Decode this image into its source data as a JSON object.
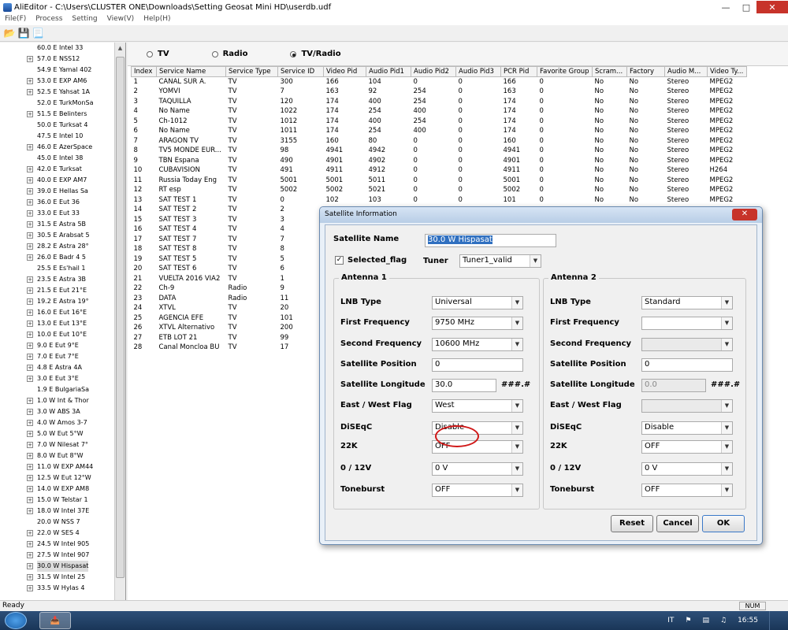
{
  "window": {
    "title": "AliEditor - C:\\Users\\CLUSTER ONE\\Downloads\\Setting Geosat Mini HD\\userdb.udf"
  },
  "menu": [
    "File(F)",
    "Process",
    "Setting",
    "View(V)",
    "Help(H)"
  ],
  "toolbar_icons": [
    "open-folder-icon",
    "save-icon",
    "open-file-icon"
  ],
  "tree": [
    {
      "label": "60.0 E Intel 33",
      "expand": false
    },
    {
      "label": "57.0 E NSS12",
      "expand": true
    },
    {
      "label": "54.9 E Yamal 402",
      "expand": false
    },
    {
      "label": "53.0 E EXP AM6",
      "expand": true
    },
    {
      "label": "52.5 E Yahsat 1A",
      "expand": true
    },
    {
      "label": "52.0 E TurkMonSa",
      "expand": false
    },
    {
      "label": "51.5 E Belinters",
      "expand": true
    },
    {
      "label": "50.0 E Turksat 4",
      "expand": false
    },
    {
      "label": "47.5 E Intel 10",
      "expand": false
    },
    {
      "label": "46.0 E AzerSpace",
      "expand": true
    },
    {
      "label": "45.0 E Intel 38",
      "expand": false
    },
    {
      "label": "42.0 E Turksat",
      "expand": true
    },
    {
      "label": "40.0 E EXP AM7",
      "expand": true
    },
    {
      "label": "39.0 E Hellas Sa",
      "expand": true
    },
    {
      "label": "36.0 E Eut 36",
      "expand": true
    },
    {
      "label": "33.0 E Eut 33",
      "expand": true
    },
    {
      "label": "31.5 E Astra 5B",
      "expand": true
    },
    {
      "label": "30.5 E Arabsat 5",
      "expand": true
    },
    {
      "label": "28.2 E Astra 28°",
      "expand": true
    },
    {
      "label": "26.0 E Badr 4 5",
      "expand": true
    },
    {
      "label": "25.5 E Es'hail 1",
      "expand": false
    },
    {
      "label": "23.5 E Astra 3B",
      "expand": true
    },
    {
      "label": "21.5 E Eut 21°E",
      "expand": true
    },
    {
      "label": "19.2 E Astra 19°",
      "expand": true
    },
    {
      "label": "16.0 E Eut 16°E",
      "expand": true
    },
    {
      "label": "13.0 E Eut 13°E",
      "expand": true
    },
    {
      "label": "10.0 E Eut 10°E",
      "expand": true
    },
    {
      "label": "9.0 E Eut 9°E",
      "expand": true
    },
    {
      "label": "7.0 E Eut 7°E",
      "expand": true
    },
    {
      "label": "4.8 E Astra 4A",
      "expand": true
    },
    {
      "label": "3.0 E Eut 3°E",
      "expand": true
    },
    {
      "label": "1.9 E BulgariaSa",
      "expand": false
    },
    {
      "label": "1.0 W Int & Thor",
      "expand": true
    },
    {
      "label": "3.0 W ABS 3A",
      "expand": true
    },
    {
      "label": "4.0 W Amos 3-7",
      "expand": true
    },
    {
      "label": "5.0 W Eut 5°W",
      "expand": true
    },
    {
      "label": "7.0 W Nilesat 7°",
      "expand": true
    },
    {
      "label": "8.0 W Eut 8°W",
      "expand": true
    },
    {
      "label": "11.0 W EXP AM44",
      "expand": true
    },
    {
      "label": "12.5 W Eut 12°W",
      "expand": true
    },
    {
      "label": "14.0 W EXP AM8",
      "expand": true
    },
    {
      "label": "15.0 W Telstar 1",
      "expand": true
    },
    {
      "label": "18.0 W Intel 37E",
      "expand": true
    },
    {
      "label": "20.0 W NSS 7",
      "expand": false
    },
    {
      "label": "22.0 W SES 4",
      "expand": true
    },
    {
      "label": "24.5 W Intel 905",
      "expand": true
    },
    {
      "label": "27.5 W Intel 907",
      "expand": true
    },
    {
      "label": "30.0 W Hispasat",
      "expand": true,
      "selected": true
    },
    {
      "label": "31.5 W Intel 25",
      "expand": true
    },
    {
      "label": "33.5 W Hylas 4",
      "expand": true
    }
  ],
  "tabs": {
    "tv": "TV",
    "radio": "Radio",
    "tvradio": "TV/Radio",
    "selected": "tvradio"
  },
  "columns": [
    "Index",
    "Service Name",
    "Service Type",
    "Service ID",
    "Video Pid",
    "Audio Pid1",
    "Audio Pid2",
    "Audio Pid3",
    "PCR Pid",
    "Favorite Group",
    "Scram...",
    "Factory",
    "Audio M...",
    "Video Ty..."
  ],
  "rows": [
    [
      "1",
      "CANAL SUR A.",
      "TV",
      "300",
      "166",
      "104",
      "0",
      "0",
      "166",
      "0",
      "No",
      "No",
      "Stereo",
      "MPEG2"
    ],
    [
      "2",
      "YOMVI",
      "TV",
      "7",
      "163",
      "92",
      "254",
      "0",
      "163",
      "0",
      "No",
      "No",
      "Stereo",
      "MPEG2"
    ],
    [
      "3",
      "TAQUILLA",
      "TV",
      "120",
      "174",
      "400",
      "254",
      "0",
      "174",
      "0",
      "No",
      "No",
      "Stereo",
      "MPEG2"
    ],
    [
      "4",
      "No Name",
      "TV",
      "1022",
      "174",
      "254",
      "400",
      "0",
      "174",
      "0",
      "No",
      "No",
      "Stereo",
      "MPEG2"
    ],
    [
      "5",
      "Ch-1012",
      "TV",
      "1012",
      "174",
      "400",
      "254",
      "0",
      "174",
      "0",
      "No",
      "No",
      "Stereo",
      "MPEG2"
    ],
    [
      "6",
      "No Name",
      "TV",
      "1011",
      "174",
      "254",
      "400",
      "0",
      "174",
      "0",
      "No",
      "No",
      "Stereo",
      "MPEG2"
    ],
    [
      "7",
      "ARAGON TV",
      "TV",
      "3155",
      "160",
      "80",
      "0",
      "0",
      "160",
      "0",
      "No",
      "No",
      "Stereo",
      "MPEG2"
    ],
    [
      "8",
      "TV5 MONDE EUR...",
      "TV",
      "98",
      "4941",
      "4942",
      "0",
      "0",
      "4941",
      "0",
      "No",
      "No",
      "Stereo",
      "MPEG2"
    ],
    [
      "9",
      "TBN Espana",
      "TV",
      "490",
      "4901",
      "4902",
      "0",
      "0",
      "4901",
      "0",
      "No",
      "No",
      "Stereo",
      "MPEG2"
    ],
    [
      "10",
      "CUBAVISION",
      "TV",
      "491",
      "4911",
      "4912",
      "0",
      "0",
      "4911",
      "0",
      "No",
      "No",
      "Stereo",
      "H264"
    ],
    [
      "11",
      "Russia Today Eng",
      "TV",
      "5001",
      "5001",
      "5011",
      "0",
      "0",
      "5001",
      "0",
      "No",
      "No",
      "Stereo",
      "MPEG2"
    ],
    [
      "12",
      "RT esp",
      "TV",
      "5002",
      "5002",
      "5021",
      "0",
      "0",
      "5002",
      "0",
      "No",
      "No",
      "Stereo",
      "MPEG2"
    ],
    [
      "13",
      "SAT TEST 1",
      "TV",
      "0",
      "102",
      "103",
      "0",
      "0",
      "101",
      "0",
      "No",
      "No",
      "Stereo",
      "MPEG2"
    ],
    [
      "14",
      "SAT TEST 2",
      "TV",
      "2",
      "",
      "",
      "",
      "",
      "",
      "",
      "",
      "",
      "",
      ""
    ],
    [
      "15",
      "SAT TEST 3",
      "TV",
      "3",
      "",
      "",
      "",
      "",
      "",
      "",
      "",
      "",
      "",
      ""
    ],
    [
      "16",
      "SAT TEST 4",
      "TV",
      "4",
      "",
      "",
      "",
      "",
      "",
      "",
      "",
      "",
      "",
      ""
    ],
    [
      "17",
      "SAT TEST 7",
      "TV",
      "7",
      "",
      "",
      "",
      "",
      "",
      "",
      "",
      "",
      "",
      ""
    ],
    [
      "18",
      "SAT TEST 8",
      "TV",
      "8",
      "",
      "",
      "",
      "",
      "",
      "",
      "",
      "",
      "",
      ""
    ],
    [
      "19",
      "SAT TEST 5",
      "TV",
      "5",
      "",
      "",
      "",
      "",
      "",
      "",
      "",
      "",
      "",
      ""
    ],
    [
      "20",
      "SAT TEST 6",
      "TV",
      "6",
      "",
      "",
      "",
      "",
      "",
      "",
      "",
      "",
      "",
      ""
    ],
    [
      "21",
      "VUELTA 2016 VIA2",
      "TV",
      "1",
      "",
      "",
      "",
      "",
      "",
      "",
      "",
      "",
      "",
      ""
    ],
    [
      "22",
      "Ch-9",
      "Radio",
      "9",
      "",
      "",
      "",
      "",
      "",
      "",
      "",
      "",
      "",
      ""
    ],
    [
      "23",
      "DATA",
      "Radio",
      "11",
      "",
      "",
      "",
      "",
      "",
      "",
      "",
      "",
      "",
      ""
    ],
    [
      "24",
      "XTVL",
      "TV",
      "20",
      "",
      "",
      "",
      "",
      "",
      "",
      "",
      "",
      "",
      ""
    ],
    [
      "25",
      "AGENCIA EFE",
      "TV",
      "101",
      "",
      "",
      "",
      "",
      "",
      "",
      "",
      "",
      "",
      ""
    ],
    [
      "26",
      "XTVL Alternativo",
      "TV",
      "200",
      "",
      "",
      "",
      "",
      "",
      "",
      "",
      "",
      "",
      ""
    ],
    [
      "27",
      "ETB LOT 21",
      "TV",
      "99",
      "",
      "",
      "",
      "",
      "",
      "",
      "",
      "",
      "",
      ""
    ],
    [
      "28",
      "Canal Moncloa BU",
      "TV",
      "17",
      "",
      "",
      "",
      "",
      "",
      "",
      "",
      "",
      "",
      ""
    ]
  ],
  "dialog": {
    "title": "Satellite Information",
    "close_label": "✕",
    "sat_name_label": "Satellite Name",
    "sat_name_value": "30.0 W Hispasat",
    "selected_flag_label": "Selected_flag",
    "selected_flag_checked": "✓",
    "tuner_label": "Tuner",
    "tuner_value": "Tuner1_valid",
    "antenna1": {
      "title": "Antenna 1",
      "lnb_type_label": "LNB Type",
      "lnb_type": "Universal",
      "first_freq_label": "First Frequency",
      "first_freq": "9750 MHz",
      "second_freq_label": "Second Frequency",
      "second_freq": "10600 MHz",
      "sat_pos_label": "Satellite Position",
      "sat_pos": "0",
      "sat_lon_label": "Satellite Longitude",
      "sat_lon": "30.0",
      "sat_lon_fmt": "###.#",
      "ew_label": "East / West Flag",
      "ew": "West",
      "diseqc_label": "DiSEqC",
      "diseqc": "Disable",
      "k22_label": "22K",
      "k22": "OFF",
      "v12_label": "0 / 12V",
      "v12": "0 V",
      "toneburst_label": "Toneburst",
      "toneburst": "OFF"
    },
    "antenna2": {
      "title": "Antenna 2",
      "lnb_type_label": "LNB Type",
      "lnb_type": "Standard",
      "first_freq_label": "First Frequency",
      "first_freq": "",
      "second_freq_label": "Second Frequency",
      "second_freq": "",
      "sat_pos_label": "Satellite Position",
      "sat_pos": "0",
      "sat_lon_label": "Satellite Longitude",
      "sat_lon": "0.0",
      "sat_lon_fmt": "###.#",
      "ew_label": "East / West Flag",
      "ew": "",
      "diseqc_label": "DiSEqC",
      "diseqc": "Disable",
      "k22_label": "22K",
      "k22": "OFF",
      "v12_label": "0 / 12V",
      "v12": "0 V",
      "toneburst_label": "Toneburst",
      "toneburst": "OFF"
    },
    "reset_label": "Reset",
    "cancel_label": "Cancel",
    "ok_label": "OK"
  },
  "status": {
    "text": "Ready",
    "num": "NUM"
  },
  "taskbar": {
    "lang": "IT",
    "time": "16:55"
  },
  "colors": {
    "selection": "#3070c0",
    "highlight_circle": "#d01818",
    "close_button": "#c7332a"
  }
}
